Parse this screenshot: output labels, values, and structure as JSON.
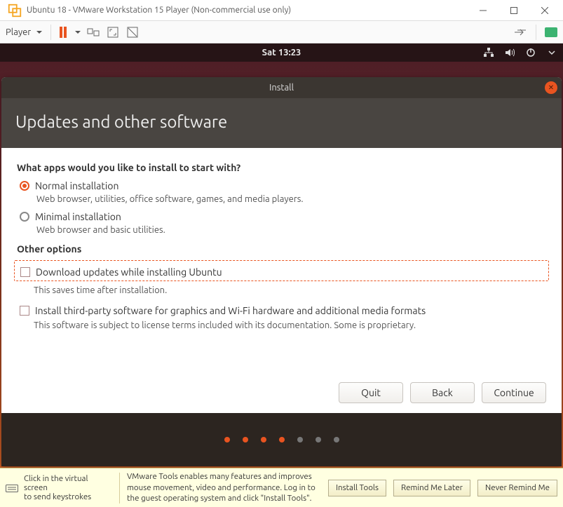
{
  "vmware": {
    "title": "Ubuntu 18 - VMware Workstation 15 Player (Non-commercial use only)",
    "player_label": "Player",
    "tools_tip_left_1": "Click in the virtual screen",
    "tools_tip_left_2": "to send keystrokes",
    "tools_msg": "VMware Tools enables many features and improves mouse movement, video and performance. Log in to the guest operating system and click \"Install Tools\".",
    "btn_install": "Install Tools",
    "btn_remind": "Remind Me Later",
    "btn_never": "Never Remind Me"
  },
  "ubuntu": {
    "clock": "Sat 13:23"
  },
  "installer": {
    "window_title": "Install",
    "heading": "Updates and other software",
    "question": "What apps would you like to install to start with?",
    "normal_label": "Normal installation",
    "normal_desc": "Web browser, utilities, office software, games, and media players.",
    "minimal_label": "Minimal installation",
    "minimal_desc": "Web browser and basic utilities.",
    "other_options": "Other options",
    "dl_updates_label": "Download updates while installing Ubuntu",
    "dl_updates_desc": "This saves time after installation.",
    "thirdparty_label": "Install third-party software for graphics and Wi-Fi hardware and additional media formats",
    "thirdparty_desc": "This software is subject to license terms included with its documentation. Some is proprietary.",
    "btn_quit": "Quit",
    "btn_back": "Back",
    "btn_continue": "Continue"
  }
}
